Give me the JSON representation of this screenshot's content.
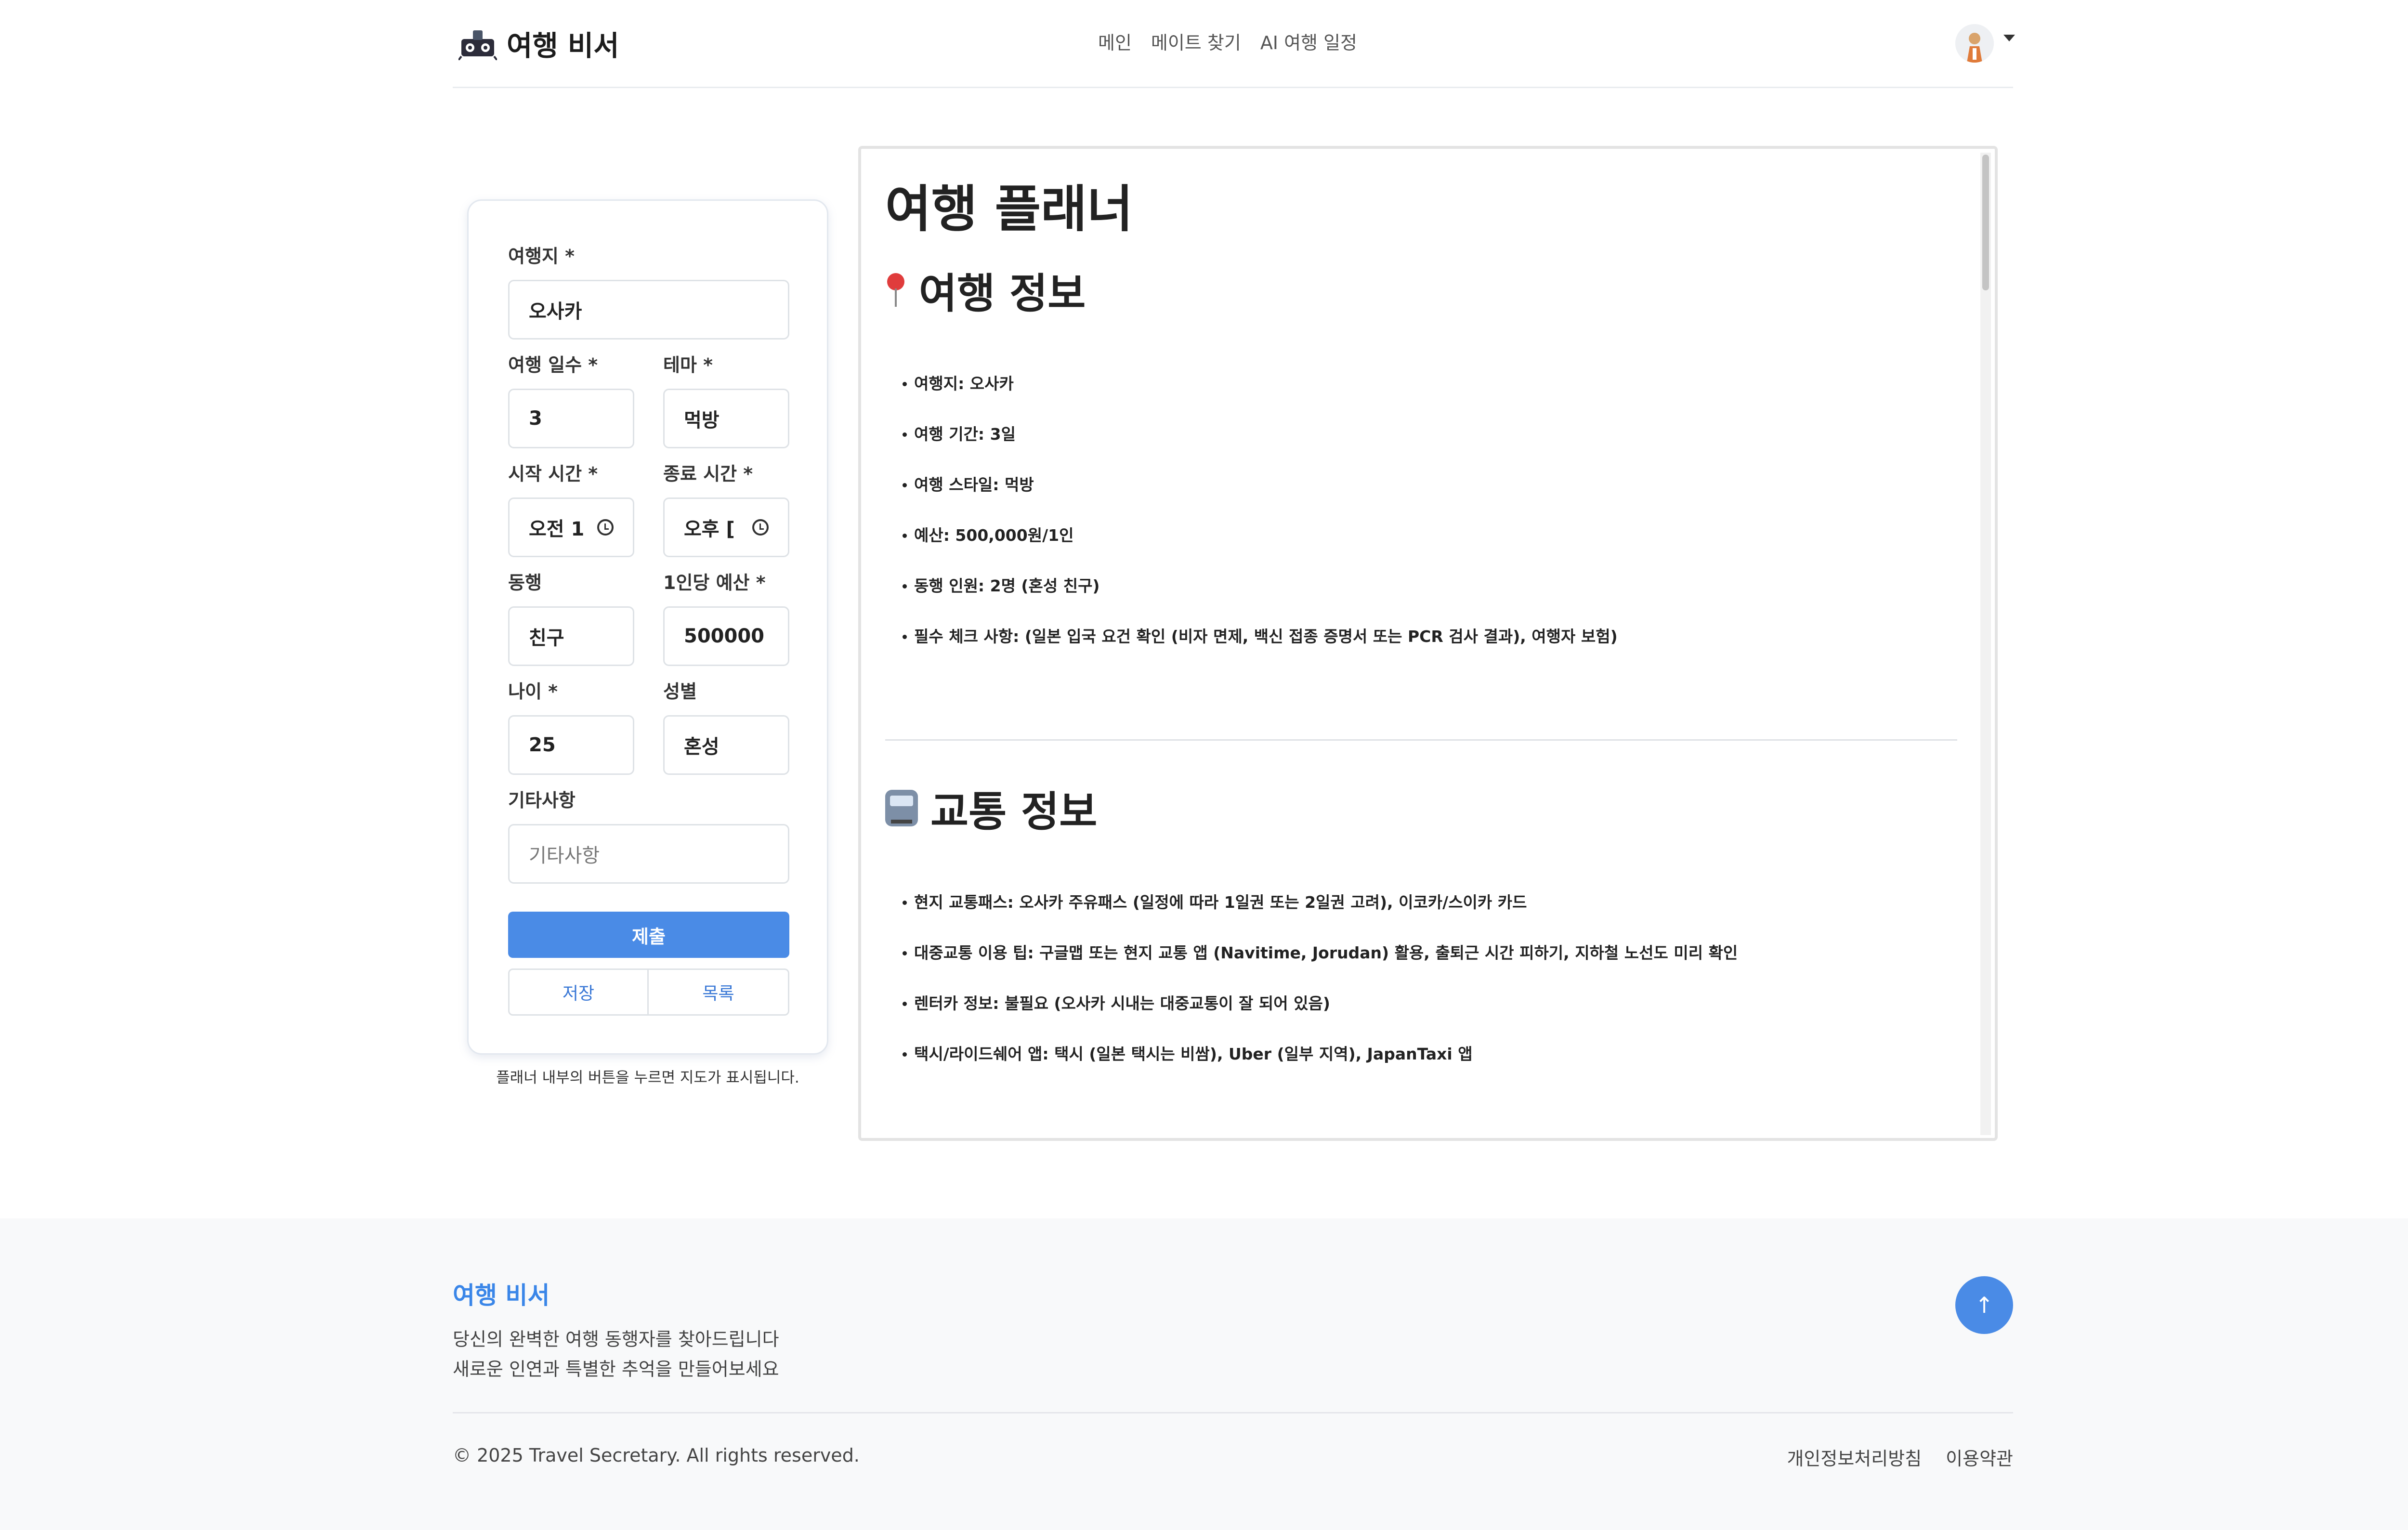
{
  "header": {
    "brand": "여행 비서",
    "nav": [
      "메인",
      "메이트 찾기",
      "AI 여행 일정"
    ]
  },
  "form": {
    "destination_label": "여행지 *",
    "destination_value": "오사카",
    "days_label": "여행 일수 *",
    "days_value": "3",
    "theme_label": "테마 *",
    "theme_value": "먹방",
    "start_label": "시작 시간 *",
    "start_value": "오전 1",
    "end_label": "종료 시간 *",
    "end_value": "오후 [",
    "companion_label": "동행",
    "companion_value": "친구",
    "budget_label": "1인당 예산 *",
    "budget_value": "500000",
    "age_label": "나이 *",
    "age_value": "25",
    "gender_label": "성별",
    "gender_value": "혼성",
    "etc_label": "기타사항",
    "etc_placeholder": "기타사항",
    "submit": "제출",
    "save": "저장",
    "list": "목록",
    "hint": "플래너 내부의 버튼을 누르면 지도가 표시됩니다."
  },
  "planner": {
    "title": "여행 플래너",
    "section1_title": "여행 정보",
    "section1_items": [
      "여행지: 오사카",
      "여행 기간: 3일",
      "여행 스타일: 먹방",
      "예산: 500,000원/1인",
      "동행 인원: 2명 (혼성 친구)",
      "필수 체크 사항:  (일본 입국 요건 확인 (비자 면제, 백신 접종 증명서 또는 PCR 검사 결과), 여행자 보험)"
    ],
    "section2_title": "교통 정보",
    "section2_items": [
      "현지 교통패스: 오사카 주유패스 (일정에 따라 1일권 또는 2일권 고려), 이코카/스이카 카드",
      "대중교통 이용 팁: 구글맵 또는 현지 교통 앱 (Navitime, Jorudan) 활용, 출퇴근 시간 피하기, 지하철 노선도 미리 확인",
      "렌터카 정보: 불필요 (오사카 시내는 대중교통이 잘 되어 있음)",
      "택시/라이드쉐어 앱: 택시 (일본 택시는 비쌈), Uber (일부 지역), JapanTaxi 앱"
    ]
  },
  "footer": {
    "brand": "여행 비서",
    "desc1": "당신의 완벽한 여행 동행자를 찾아드립니다",
    "desc2": "새로운 인연과 특별한 추억을 만들어보세요",
    "copyright": "© 2025 Travel Secretary. All rights reserved.",
    "privacy": "개인정보처리방침",
    "terms": "이용약관",
    "scroll_top": "↑"
  }
}
